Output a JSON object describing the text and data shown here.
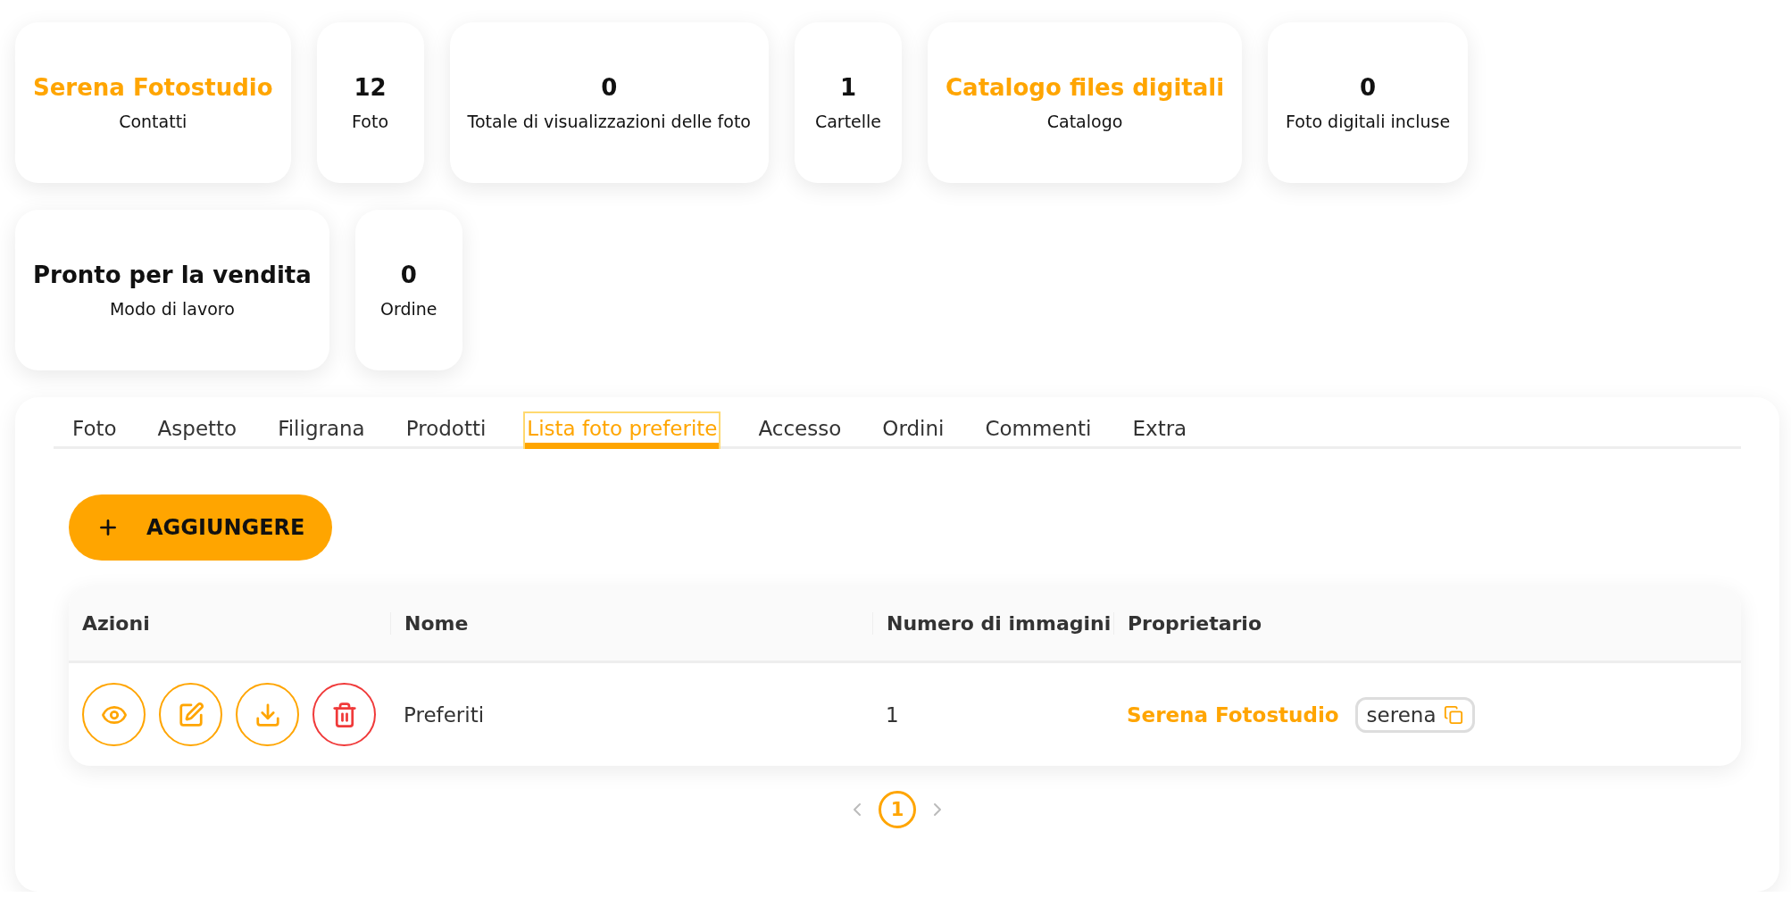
{
  "stats_rows": [
    [
      {
        "value": "Serena Fotostudio",
        "label": "Contatti",
        "highlighted": true
      },
      {
        "value": "12",
        "label": "Foto",
        "highlighted": false
      },
      {
        "value": "0",
        "label": "Totale di visualizzazioni delle foto",
        "highlighted": false
      },
      {
        "value": "1",
        "label": "Cartelle",
        "highlighted": false
      },
      {
        "value": "Catalogo files digitali",
        "label": "Catalogo",
        "highlighted": true
      },
      {
        "value": "0",
        "label": "Foto digitali incluse",
        "highlighted": false
      }
    ],
    [
      {
        "value": "Pronto per la vendita",
        "label": "Modo di lavoro",
        "highlighted": false
      },
      {
        "value": "0",
        "label": "Ordine",
        "highlighted": false
      }
    ]
  ],
  "tabs": [
    {
      "label": "Foto",
      "selected": false
    },
    {
      "label": "Aspetto",
      "selected": false
    },
    {
      "label": "Filigrana",
      "selected": false
    },
    {
      "label": "Prodotti",
      "selected": false
    },
    {
      "label": "Lista foto preferite",
      "selected": true
    },
    {
      "label": "Accesso",
      "selected": false
    },
    {
      "label": "Ordini",
      "selected": false
    },
    {
      "label": "Commenti",
      "selected": false
    },
    {
      "label": "Extra",
      "selected": false
    }
  ],
  "add_button": {
    "label": "AGGIUNGERE"
  },
  "table": {
    "columns": [
      "Azioni",
      "Nome",
      "Numero di immagini",
      "Proprietario"
    ],
    "rows": [
      {
        "actions": [
          {
            "kind": "view"
          },
          {
            "kind": "edit"
          },
          {
            "kind": "download"
          },
          {
            "kind": "delete"
          }
        ],
        "name": "Preferiti",
        "count": "1",
        "owner": "Serena Fotostudio",
        "owner_tag": "serena"
      }
    ]
  },
  "pagination": {
    "prev_disabled": true,
    "next_disabled": true,
    "pages": [
      {
        "label": "1",
        "selected": true
      }
    ]
  }
}
